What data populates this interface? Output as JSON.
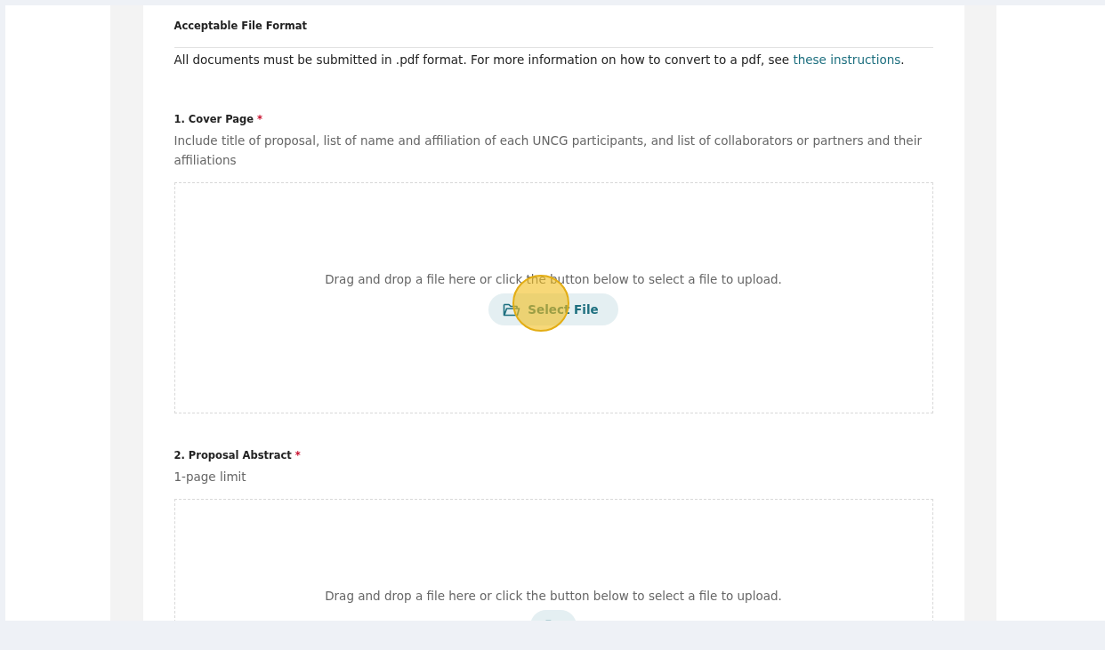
{
  "format_section": {
    "heading": "Acceptable File Format",
    "text": "All documents must be submitted in .pdf format.  For more information on how to convert to a pdf, see ",
    "link": "these instructions",
    "after_link": "."
  },
  "uploads": [
    {
      "title": "1. Cover Page",
      "required_mark": "*",
      "description": "Include title of proposal, list of name and affiliation of each UNCG participants, and list of collaborators or partners and their affiliations",
      "drop_text": "Drag and drop a file here or click the button below to select a file to upload.",
      "button": "Select File",
      "highlighted": true
    },
    {
      "title": "2. Proposal Abstract",
      "required_mark": "*",
      "description": "1-page limit",
      "drop_text": "Drag and drop a file here or click the button below to select a file to upload.",
      "highlighted": false
    }
  ]
}
